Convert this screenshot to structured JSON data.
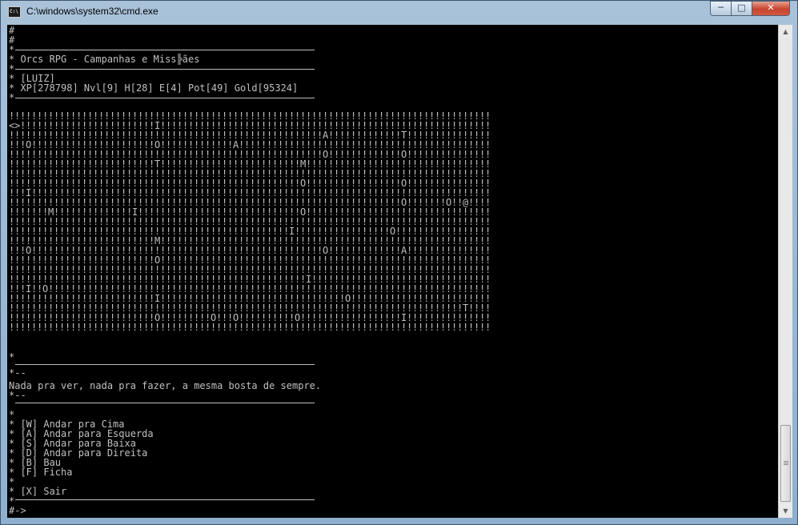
{
  "window": {
    "title": "C:\\windows\\system32\\cmd.exe",
    "minimize": "─",
    "maximize": "□",
    "close": "✕",
    "icon": "cmd-icon"
  },
  "console_lines": [
    "#",
    "#",
    "*",
    "* Orcs RPG - Campanhas e Miss╠ães",
    "*",
    "* [LUIZ]",
    "* XP[278798] Nvl[9] H[28] E[4] Pot[49] Gold[95324]",
    "*"
  ],
  "map_rows": [
    "!!!!!!!!!!!!!!!!!!!!!!!!!!!!!!!!!!!!!!!!!!!!!!!!!!!!!!!!!!!!!!!!!!!!!!!!!!!!!!!!!!!!!!",
    "<>!!!!!!!!!!!!!!!!!!!!!!!!I!!!!!!!!!!!!!!!!!!!!!!!!!!!!!!!!!!!!!!!!!!!!!!!!!!!!!!!!!!!",
    "!!!!!!!!!!!!!!!!!!!!!!!!!!!!!!!!!!!!!!!!!!!!!!!!!!!!!!!!A!!!!!!!!!!!!!T!!!!!!!!!!!!!!!",
    "!!!O!!!!!!!!!!!!!!!!!!!!!!O!!!!!!!!!!!!!A!!!!!!!!!!!!!!!!!!!!!!!!!!!!!!!!!!!!!!!!!!!!!",
    "!!!!!!!!!!!!!!!!!!!!!!!!!!!!!!!!!!!!!!!!!!!!!!!!!!!!!!!!O!!!!!!!!!!!!!O!!!!!!!!!!!!!!!",
    "!!!!!!!!!!!!!!!!!!!!!!!!!!T!!!!!!!!!!!!!!!!!!!!!!!!!M!!!!!!!!!!!!!!!!!!!!!!!!!!!!!!!!!",
    "!!!!!!!!!!!!!!!!!!!!!!!!!!!!!!!!!!!!!!!!!!!!!!!!!!!!!!!!!!!!!!!!!!!!!!!!!!!!!!!!!!!!!!",
    "!!!!!!!!!!!!!!!!!!!!!!!!!!!!!!!!!!!!!!!!!!!!!!!!!!!!O!!!!!!!!!!!!!!!!!O!!!!!!!!!!!!!!!",
    "!!!I!!!!!!!!!!!!!!!!!!!!!!!!!!!!!!!!!!!!!!!!!!!!!!!!!!!!!!!!!!!!!!!!!!!!!!!!!!!!!!!!!!",
    "!!!!!!!!!!!!!!!!!!!!!!!!!!!!!!!!!!!!!!!!!!!!!!!!!!!!!!!!!!!!!!!!!!!!!!O!!!!!!!O!!@!!!!",
    "!!!!!!!M!!!!!!!!!!!!!!I!!!!!!!!!!!!!!!!!!!!!!!!!!!!!O!!!!!!!!!!!!!!!!!!!!!!!!!!!!!!!!!",
    "!!!!!!!!!!!!!!!!!!!!!!!!!!!!!!!!!!!!!!!!!!!!!!!!!!!!!!!!!!!!!!!!!!!!!!!!!!!!!!!!!!!!!!",
    "!!!!!!!!!!!!!!!!!!!!!!!!!!!!!!!!!!!!!!!!!!!!!!!!!!I!!!!!!!!!!!!!!!!!O!!!!!!!!!!!!!!!!!",
    "!!!!!!!!!!!!!!!!!!!!!!!!!!M!!!!!!!!!!!!!!!!!!!!!!!!!!!!!!!!!!!!!!!!!!!!!!!!!!!!!!!!!!!",
    "!!!O!!!!!!!!!!!!!!!!!!!!!!!!!!!!!!!!!!!!!!!!!!!!!!!!!!!!O!!!!!!!!!!!!!A!!!!!!!!!!!!!!!",
    "!!!!!!!!!!!!!!!!!!!!!!!!!!O!!!!!!!!!!!!!!!!!!!!!!!!!!!!!!!!!!!!!!!!!!!!!!!!!!!!!!!!!!!",
    "!!!!!!!!!!!!!!!!!!!!!!!!!!!!!!!!!!!!!!!!!!!!!!!!!!!!!!!!!!!!!!!!!!!!!!!!!!!!!!!!!!!!!!",
    "!!!!!!!!!!!!!!!!!!!!!!!!!!!!!!!!!!!!!!!!!!!!!!!!!!!!!I!!!!!!!!!!!!!!!!!!!!!!!!!!!!!!!!",
    "!!!I!!O!!!!!!!!!!!!!!!!!!!!!!!!!!!!!!!!!!!!!!!!!!!!!!!!!!!!!!!!!!!!!!!!!!!!!!!!!!!!!!!",
    "!!!!!!!!!!!!!!!!!!!!!!!!!!I!!!!!!!!!!!!!!!!!!!!!!!!!!!!!!!!!O!!!!!!!!!!!!!!!!!!!!!!!!!",
    "!!!!!!!!!!!!!!!!!!!!!!!!!!!!!!!!!!!!!!!!!!!!!!!!!!!!!!!!!!!!!!!!!!!!!!!!!!!!!!!!!T!!!!",
    "!!!!!!!!!!!!!!!!!!!!!!!!!!O!!!!!!!!!O!!!O!!!!!!!!!!O!!!!!!!!!!!!!!!!!!I!!!!!!!!!!!!!!!",
    "!!!!!!!!!!!!!!!!!!!!!!!!!!!!!!!!!!!!!!!!!!!!!!!!!!!!!!!!!!!!!!!!!!!!!!!!!!!!!!!!!!!!!!"
  ],
  "after_map": "*",
  "message": {
    "top_prefix": "*",
    "open": "*--",
    "text": "Nada pra ver, nada pra fazer, a mesma bosta de sempre.",
    "close": "*--",
    "bottom_prefix": ""
  },
  "menu_lines": [
    "*",
    "* [W] Andar pra Cima",
    "* [A] Andar para Esquerda",
    "* [S] Andar para Baixa",
    "* [D] Andar para Direita",
    "* [B] Bau",
    "* [F] Ficha",
    "*",
    "* [X] Sair",
    "*"
  ],
  "prompt": "#->",
  "scrollbar": {
    "up": "▲",
    "down": "▼"
  }
}
